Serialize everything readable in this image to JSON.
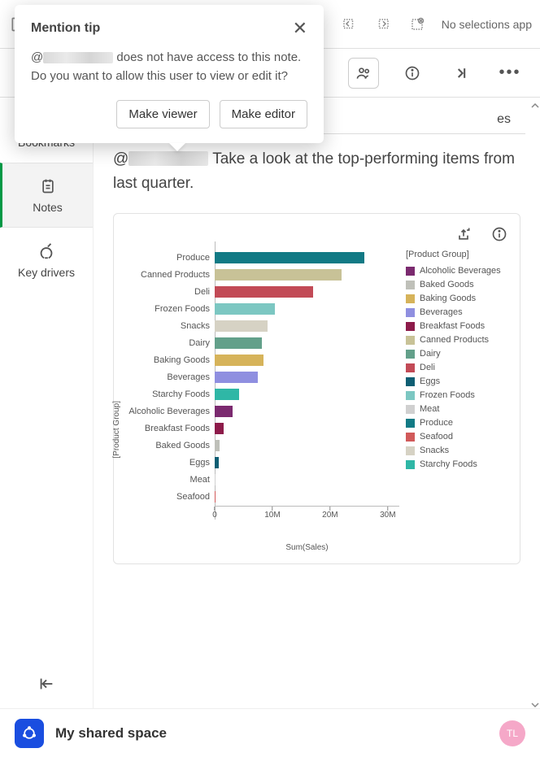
{
  "topbar": {
    "no_selections": "No selections app"
  },
  "popover": {
    "title": "Mention tip",
    "body_prefix": "@",
    "body_after": " does not have access to this note. Do you want to allow this user to view or edit it?",
    "make_viewer": "Make viewer",
    "make_editor": "Make editor"
  },
  "sidebar": {
    "items": [
      {
        "label": "Bookmarks"
      },
      {
        "label": "Notes"
      },
      {
        "label": "Key drivers"
      }
    ]
  },
  "note": {
    "mention_prefix": "@",
    "text_after": " Take a look at the top-performing items from last quarter."
  },
  "footer": {
    "space_label": "My shared space",
    "avatar_initials": "TL"
  },
  "chart_data": {
    "type": "bar",
    "orientation": "horizontal",
    "title": "",
    "xlabel": "Sum(Sales)",
    "ylabel": "[Product Group]",
    "xlim": [
      0,
      32000000
    ],
    "ticks": [
      0,
      10000000,
      20000000,
      30000000
    ],
    "tick_labels": [
      "0",
      "10M",
      "20M",
      "30M"
    ],
    "legend_title": "[Product Group]",
    "legend_order": [
      "Alcoholic Beverages",
      "Baked Goods",
      "Baking Goods",
      "Beverages",
      "Breakfast Foods",
      "Canned Products",
      "Dairy",
      "Deli",
      "Eggs",
      "Frozen Foods",
      "Meat",
      "Produce",
      "Seafood",
      "Snacks",
      "Starchy Foods"
    ],
    "colors": {
      "Alcoholic Beverages": "#7b2a6f",
      "Baked Goods": "#bfc0b9",
      "Baking Goods": "#d6b35a",
      "Beverages": "#8f8fe0",
      "Breakfast Foods": "#8d1b4a",
      "Canned Products": "#c8c297",
      "Dairy": "#63a08a",
      "Deli": "#c24a56",
      "Eggs": "#0f5e73",
      "Frozen Foods": "#7cc7c2",
      "Meat": "#d0d0d0",
      "Produce": "#127a85",
      "Seafood": "#d15a5a",
      "Snacks": "#d6d2c4",
      "Starchy Foods": "#2fb7a6"
    },
    "categories": [
      "Produce",
      "Canned Products",
      "Deli",
      "Frozen Foods",
      "Snacks",
      "Dairy",
      "Baking Goods",
      "Beverages",
      "Starchy Foods",
      "Alcoholic Beverages",
      "Breakfast Foods",
      "Baked Goods",
      "Eggs",
      "Meat",
      "Seafood"
    ],
    "values": [
      26000000,
      22000000,
      17000000,
      10500000,
      9100000,
      8200000,
      8500000,
      7500000,
      4200000,
      3100000,
      1500000,
      900000,
      700000,
      200000,
      100000
    ]
  }
}
